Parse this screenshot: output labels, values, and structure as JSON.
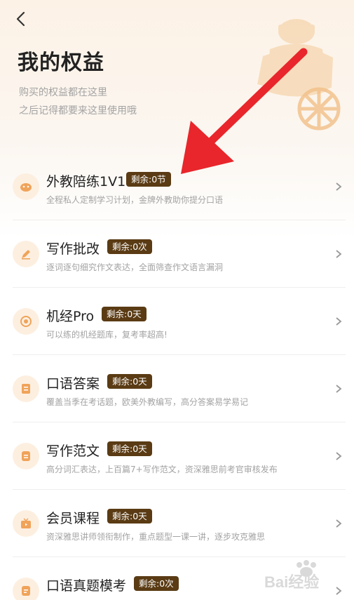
{
  "header": {
    "title": "我的权益",
    "subtitle_line1": "购买的权益都在这里",
    "subtitle_line2": "之后记得都要来这里使用哦"
  },
  "colors": {
    "badge_bg": "#5a3b14",
    "icon_bg": "#fdefe0",
    "icon_fg": "#f0a35a",
    "annotation_arrow": "#e8262b"
  },
  "benefits": [
    {
      "name": "外教陪练1V1",
      "badge": "剩余:0节",
      "desc": "全程私人定制学习计划，金牌外教助你提分口语",
      "icon": "face-icon"
    },
    {
      "name": "写作批改",
      "badge": "剩余:0次",
      "desc": "逐词逐句细究作文表达，全面筛查作文语言漏洞",
      "icon": "pen-icon"
    },
    {
      "name": "机经Pro",
      "badge": "剩余:0天",
      "desc": "可以练的机经题库，复考率超高!",
      "icon": "target-icon"
    },
    {
      "name": "口语答案",
      "badge": "剩余:0天",
      "desc": "覆盖当季在考话题，欧美外教编写，高分答案易学易记",
      "icon": "document-icon"
    },
    {
      "name": "写作范文",
      "badge": "剩余:0天",
      "desc": "高分词汇表达，上百篇7+写作范文，资深雅思前考官审核发布",
      "icon": "note-icon"
    },
    {
      "name": "会员课程",
      "badge": "剩余:0天",
      "desc": "资深雅思讲师领衔制作，重点题型一课一讲，逐步攻克雅思",
      "icon": "tv-icon"
    },
    {
      "name": "口语真题模考",
      "badge": "剩余:0次",
      "desc": "",
      "icon": "exam-icon"
    }
  ],
  "watermark": {
    "text": "Bai经验"
  }
}
